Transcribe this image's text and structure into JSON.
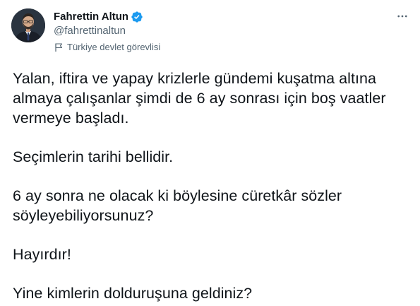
{
  "author": {
    "display_name": "Fahrettin Altun",
    "handle": "@fahrettinaltun",
    "label": "Türkiye devlet görevlisi",
    "verified": true,
    "avatar_bg": "#1c2733"
  },
  "icons": {
    "verified": "verified-badge-icon",
    "label": "flag-icon",
    "more": "more-icon"
  },
  "colors": {
    "text": "#0f1419",
    "secondary": "#536471",
    "verified": "#1d9bf0"
  },
  "tweet": {
    "paragraphs": [
      "Yalan, iftira ve yapay krizlerle gündemi kuşatma altına almaya çalışanlar şimdi de 6 ay sonrası için boş vaatler vermeye başladı.",
      "Seçimlerin tarihi bellidir.",
      "6 ay sonra ne olacak ki böylesine cüretkâr sözler söyleyebiliyorsunuz?",
      "Hayırdır!",
      "Yine kimlerin dolduruşuna geldiniz?"
    ]
  }
}
